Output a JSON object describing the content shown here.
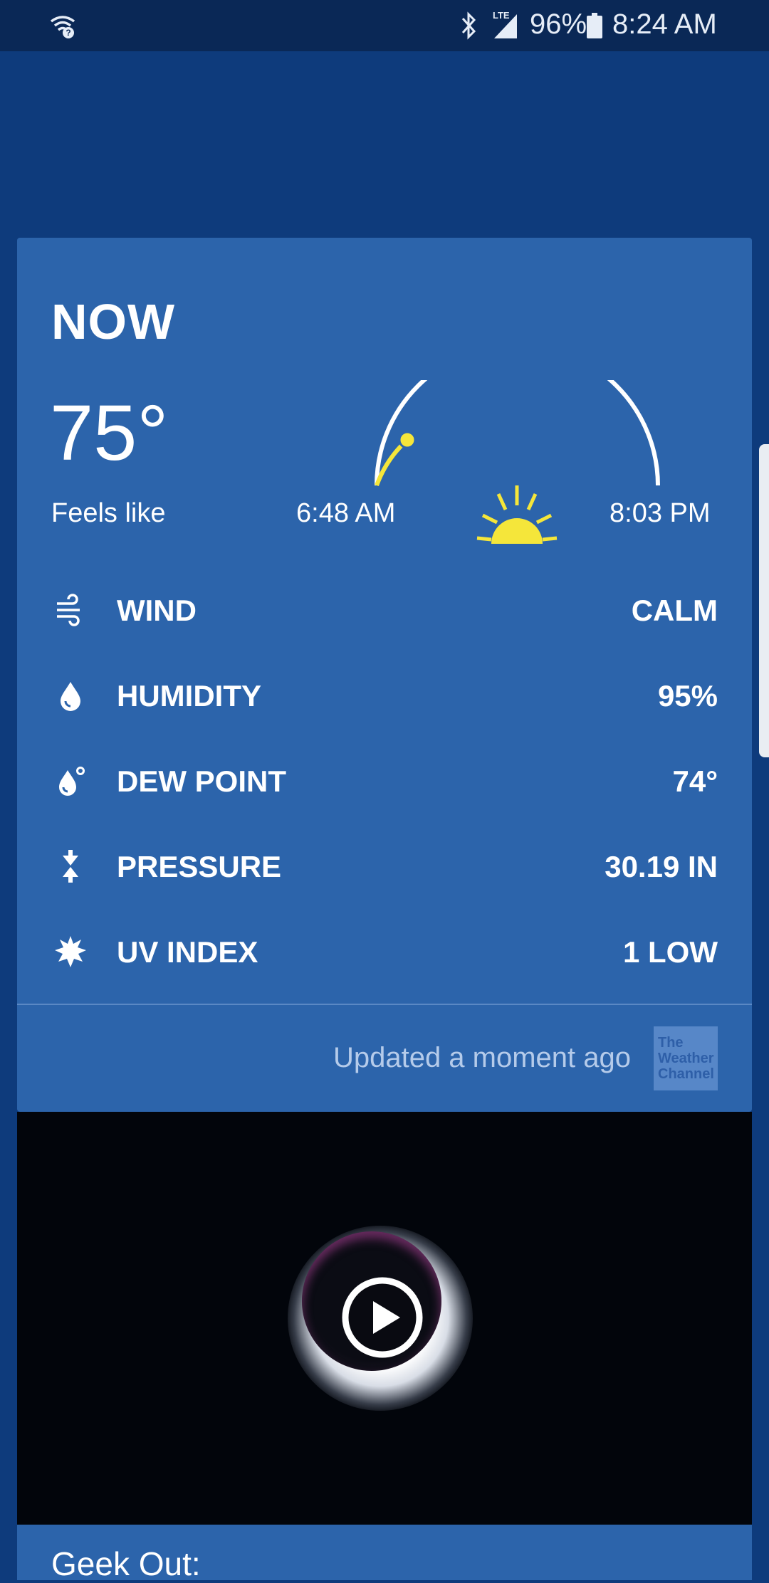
{
  "status_bar": {
    "lte": "LTE",
    "battery_percent": "96%",
    "time": "8:24 AM",
    "icons": [
      "wifi-question-icon",
      "bluetooth-icon",
      "signal-icon",
      "battery-icon"
    ]
  },
  "now_card": {
    "title": "NOW",
    "temperature": "75°",
    "feels_like_label": "Feels like",
    "sunrise": "6:48 AM",
    "sunset": "8:03 PM",
    "conditions": [
      {
        "icon": "wind-icon",
        "label": "WIND",
        "value": "CALM"
      },
      {
        "icon": "humidity-drop-icon",
        "label": "HUMIDITY",
        "value": "95%"
      },
      {
        "icon": "dew-point-icon",
        "label": "DEW POINT",
        "value": "74°"
      },
      {
        "icon": "pressure-icon",
        "label": "PRESSURE",
        "value": "30.19 IN"
      },
      {
        "icon": "uv-sun-icon",
        "label": "UV INDEX",
        "value": "1 LOW"
      }
    ],
    "updated_text": "Updated a moment ago",
    "logo_text": [
      "The",
      "Weather",
      "Channel"
    ]
  },
  "video": {
    "play_icon": "play-icon"
  },
  "next_card": {
    "title": "Geek Out:"
  },
  "colors": {
    "background": "#0e3b7c",
    "card": "#2c64ab",
    "status_bar": "#0a2856",
    "sun_yellow": "#f5e63a",
    "updated_text": "#b5cbea"
  }
}
